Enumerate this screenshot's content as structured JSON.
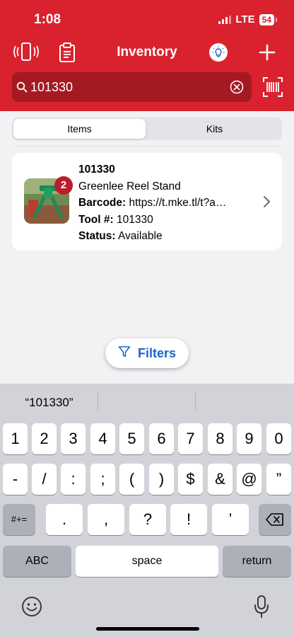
{
  "status_bar": {
    "time": "1:08",
    "network": "LTE",
    "battery": "54"
  },
  "header": {
    "title": "Inventory"
  },
  "search": {
    "value": "101330"
  },
  "segments": {
    "items": "Items",
    "kits": "Kits"
  },
  "item": {
    "count_badge": "2",
    "id": "101330",
    "name": "Greenlee Reel Stand",
    "barcode_label": "Barcode:",
    "barcode_value": "https://t.mke.tl/t?a…",
    "tool_label": "Tool #:",
    "tool_value": "101330",
    "status_label": "Status:",
    "status_value": "Available"
  },
  "filters": {
    "label": "Filters"
  },
  "keyboard": {
    "suggestion": "“101330”",
    "row1": [
      "1",
      "2",
      "3",
      "4",
      "5",
      "6",
      "7",
      "8",
      "9",
      "0"
    ],
    "row2": [
      "-",
      "/",
      ":",
      ";",
      "(",
      ")",
      "$",
      "&",
      "@",
      "”"
    ],
    "row3": {
      "shift": "#+=",
      "keys": [
        ".",
        ",",
        "?",
        "!",
        "’"
      ]
    },
    "row4": {
      "abc": "ABC",
      "space": "space",
      "return": "return"
    }
  },
  "colors": {
    "brand_red": "#d9222e",
    "link_blue": "#1f63c7"
  }
}
